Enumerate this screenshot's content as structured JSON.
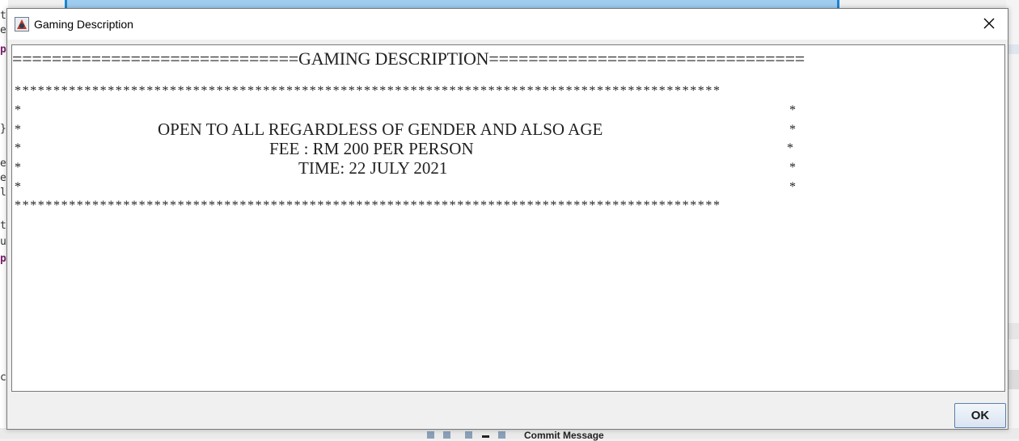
{
  "window": {
    "title": "Gaming Description",
    "close_icon": "close-icon",
    "app_icon": "java-app-icon"
  },
  "content": {
    "header_line": "=============================GAMING DESCRIPTION================================",
    "star_row": "*******************************************************************************************",
    "border_star": "*",
    "lines": [
      "OPEN TO ALL REGARDLESS OF GENDER AND ALSO AGE",
      "FEE : RM 200 PER PERSON",
      "TIME: 22 JULY 2021"
    ]
  },
  "buttons": {
    "ok_label": "OK"
  },
  "background": {
    "commit_label": "Commit Message",
    "left_chars": [
      "t",
      "e",
      "p",
      "}",
      "e",
      "e",
      "l",
      "t",
      "u",
      "p",
      "c"
    ]
  },
  "colors": {
    "accent_blue": "#1b85d4",
    "button_border": "#5b7fa6"
  }
}
